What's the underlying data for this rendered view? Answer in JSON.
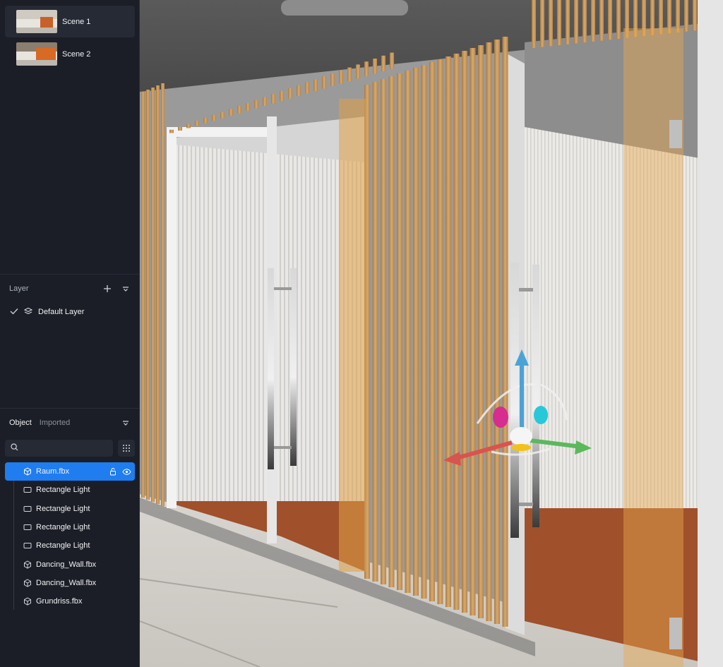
{
  "scenes": [
    {
      "label": "Scene 1",
      "active": true
    },
    {
      "label": "Scene 2",
      "active": false
    }
  ],
  "layer_panel": {
    "title": "Layer",
    "add_icon": "plus-icon",
    "collapse_icon": "chevron-down-icon",
    "layers": [
      {
        "label": "Default Layer",
        "checked": true,
        "icon": "layers-icon"
      }
    ]
  },
  "object_panel": {
    "tabs": [
      "Object",
      "Imported"
    ],
    "active_tab": "Object",
    "search": {
      "value": "",
      "placeholder": ""
    },
    "items": [
      {
        "label": "Raum.fbx",
        "icon": "cube-icon",
        "selected": true
      },
      {
        "label": "Rectangle Light",
        "icon": "rectangle-icon"
      },
      {
        "label": "Rectangle Light",
        "icon": "rectangle-icon"
      },
      {
        "label": "Rectangle Light",
        "icon": "rectangle-icon"
      },
      {
        "label": "Rectangle Light",
        "icon": "rectangle-icon"
      },
      {
        "label": "Dancing_Wall.fbx",
        "icon": "cube-icon"
      },
      {
        "label": "Dancing_Wall.fbx",
        "icon": "cube-icon"
      },
      {
        "label": "Grundriss.fbx",
        "icon": "cube-icon"
      }
    ]
  },
  "colors": {
    "accent": "#1f7df0",
    "panel_bg": "#1b1e26",
    "gizmo_x": "#d9534f",
    "gizmo_y": "#4aa3d6",
    "gizmo_z": "#5cb85c"
  }
}
